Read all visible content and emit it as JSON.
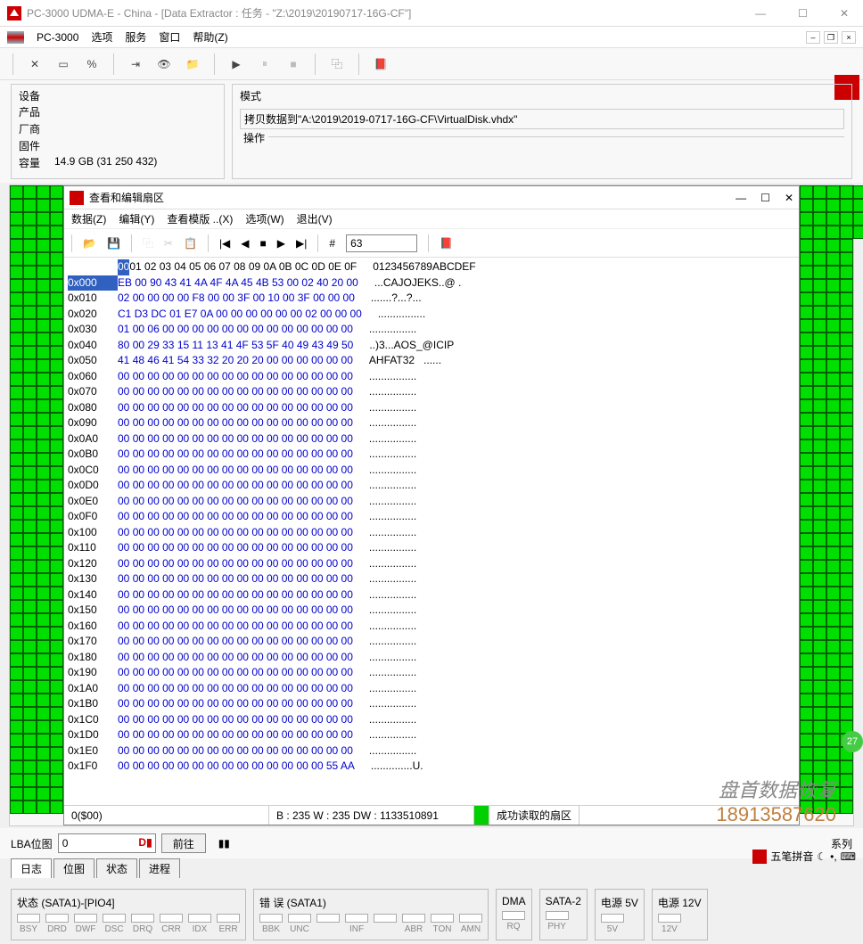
{
  "window": {
    "title": "PC-3000 UDMA-E - China - [Data Extractor : 任务 - \"Z:\\2019\\20190717-16G-CF\"]"
  },
  "menu": {
    "items": [
      "PC-3000",
      "选项",
      "服务",
      "窗口",
      "帮助(Z)"
    ]
  },
  "info": {
    "device_label": "设备",
    "product_label": "产品",
    "vendor_label": "厂商",
    "firmware_label": "固件",
    "capacity_label": "容量",
    "capacity_value": "14.9 GB (31 250 432)",
    "mode_label": "模式",
    "mode_value": "拷贝数据到\"A:\\2019\\2019-0717-16G-CF\\VirtualDisk.vhdx\"",
    "operation_label": "操作"
  },
  "hex_window": {
    "title": "查看和编辑扇区",
    "menu": [
      "数据(Z)",
      "编辑(Y)",
      "查看模版 ..(X)",
      "选项(W)",
      "退出(V)"
    ],
    "input_value": "63",
    "header_offset": "00",
    "header_cols": "01 02 03 04 05 06 07 08 09 0A 0B 0C 0D 0E 0F",
    "header_ascii": "0123456789ABCDEF",
    "rows": [
      {
        "off": "0x000",
        "hex": "EB 00 90 43 41 4A 4F 4A 45 4B 53 00 02 40 20 00",
        "ascii": "...CAJOJEKS..@ ."
      },
      {
        "off": "0x010",
        "hex": "02 00 00 00 00 F8 00 00 3F 00 10 00 3F 00 00 00",
        "ascii": ".......?...?..."
      },
      {
        "off": "0x020",
        "hex": "C1 D3 DC 01 E7 0A 00 00 00 00 00 00 02 00 00 00",
        "ascii": "................"
      },
      {
        "off": "0x030",
        "hex": "01 00 06 00 00 00 00 00 00 00 00 00 00 00 00 00",
        "ascii": "................"
      },
      {
        "off": "0x040",
        "hex": "80 00 29 33 15 11 13 41 4F 53 5F 40 49 43 49 50",
        "ascii": "..)3...AOS_@ICIP"
      },
      {
        "off": "0x050",
        "hex": "41 48 46 41 54 33 32 20 20 20 00 00 00 00 00 00",
        "ascii": "AHFAT32   ......"
      },
      {
        "off": "0x060",
        "hex": "00 00 00 00 00 00 00 00 00 00 00 00 00 00 00 00",
        "ascii": "................"
      },
      {
        "off": "0x070",
        "hex": "00 00 00 00 00 00 00 00 00 00 00 00 00 00 00 00",
        "ascii": "................"
      },
      {
        "off": "0x080",
        "hex": "00 00 00 00 00 00 00 00 00 00 00 00 00 00 00 00",
        "ascii": "................"
      },
      {
        "off": "0x090",
        "hex": "00 00 00 00 00 00 00 00 00 00 00 00 00 00 00 00",
        "ascii": "................"
      },
      {
        "off": "0x0A0",
        "hex": "00 00 00 00 00 00 00 00 00 00 00 00 00 00 00 00",
        "ascii": "................"
      },
      {
        "off": "0x0B0",
        "hex": "00 00 00 00 00 00 00 00 00 00 00 00 00 00 00 00",
        "ascii": "................"
      },
      {
        "off": "0x0C0",
        "hex": "00 00 00 00 00 00 00 00 00 00 00 00 00 00 00 00",
        "ascii": "................"
      },
      {
        "off": "0x0D0",
        "hex": "00 00 00 00 00 00 00 00 00 00 00 00 00 00 00 00",
        "ascii": "................"
      },
      {
        "off": "0x0E0",
        "hex": "00 00 00 00 00 00 00 00 00 00 00 00 00 00 00 00",
        "ascii": "................"
      },
      {
        "off": "0x0F0",
        "hex": "00 00 00 00 00 00 00 00 00 00 00 00 00 00 00 00",
        "ascii": "................"
      },
      {
        "off": "0x100",
        "hex": "00 00 00 00 00 00 00 00 00 00 00 00 00 00 00 00",
        "ascii": "................"
      },
      {
        "off": "0x110",
        "hex": "00 00 00 00 00 00 00 00 00 00 00 00 00 00 00 00",
        "ascii": "................"
      },
      {
        "off": "0x120",
        "hex": "00 00 00 00 00 00 00 00 00 00 00 00 00 00 00 00",
        "ascii": "................"
      },
      {
        "off": "0x130",
        "hex": "00 00 00 00 00 00 00 00 00 00 00 00 00 00 00 00",
        "ascii": "................"
      },
      {
        "off": "0x140",
        "hex": "00 00 00 00 00 00 00 00 00 00 00 00 00 00 00 00",
        "ascii": "................"
      },
      {
        "off": "0x150",
        "hex": "00 00 00 00 00 00 00 00 00 00 00 00 00 00 00 00",
        "ascii": "................"
      },
      {
        "off": "0x160",
        "hex": "00 00 00 00 00 00 00 00 00 00 00 00 00 00 00 00",
        "ascii": "................"
      },
      {
        "off": "0x170",
        "hex": "00 00 00 00 00 00 00 00 00 00 00 00 00 00 00 00",
        "ascii": "................"
      },
      {
        "off": "0x180",
        "hex": "00 00 00 00 00 00 00 00 00 00 00 00 00 00 00 00",
        "ascii": "................"
      },
      {
        "off": "0x190",
        "hex": "00 00 00 00 00 00 00 00 00 00 00 00 00 00 00 00",
        "ascii": "................"
      },
      {
        "off": "0x1A0",
        "hex": "00 00 00 00 00 00 00 00 00 00 00 00 00 00 00 00",
        "ascii": "................"
      },
      {
        "off": "0x1B0",
        "hex": "00 00 00 00 00 00 00 00 00 00 00 00 00 00 00 00",
        "ascii": "................"
      },
      {
        "off": "0x1C0",
        "hex": "00 00 00 00 00 00 00 00 00 00 00 00 00 00 00 00",
        "ascii": "................"
      },
      {
        "off": "0x1D0",
        "hex": "00 00 00 00 00 00 00 00 00 00 00 00 00 00 00 00",
        "ascii": "................"
      },
      {
        "off": "0x1E0",
        "hex": "00 00 00 00 00 00 00 00 00 00 00 00 00 00 00 00",
        "ascii": "................"
      },
      {
        "off": "0x1F0",
        "hex": "00 00 00 00 00 00 00 00 00 00 00 00 00 00 55 AA",
        "ascii": "..............U."
      }
    ],
    "status": {
      "offset": "0($00)",
      "bwdw": "B : 235 W : 235 DW : 1133510891",
      "message": "成功读取的扇区"
    }
  },
  "lba": {
    "label": "LBA位图",
    "value": "0",
    "go": "前往",
    "series": "系列"
  },
  "tabs": [
    "日志",
    "位图",
    "状态",
    "进程"
  ],
  "ime": {
    "label": "五笔拼音"
  },
  "status_panels": {
    "sata1": {
      "label": "状态 (SATA1)-[PIO4]",
      "items": [
        "BSY",
        "DRD",
        "DWF",
        "DSC",
        "DRQ",
        "CRR",
        "IDX",
        "ERR"
      ]
    },
    "err": {
      "label": "错 误 (SATA1)",
      "items": [
        "BBK",
        "UNC",
        "",
        "INF",
        "",
        "ABR",
        "TON",
        "AMN"
      ]
    },
    "dma": {
      "label": "DMA",
      "items": [
        "RQ"
      ]
    },
    "sata2": {
      "label": "SATA-2",
      "items": [
        "PHY"
      ]
    },
    "p5v": {
      "label": "电源 5V",
      "items": [
        "5V"
      ]
    },
    "p12v": {
      "label": "电源 12V",
      "items": [
        "12V"
      ]
    }
  },
  "watermark": {
    "line1": "盘首数据恢复",
    "line2": "18913587620"
  },
  "badge": "27"
}
